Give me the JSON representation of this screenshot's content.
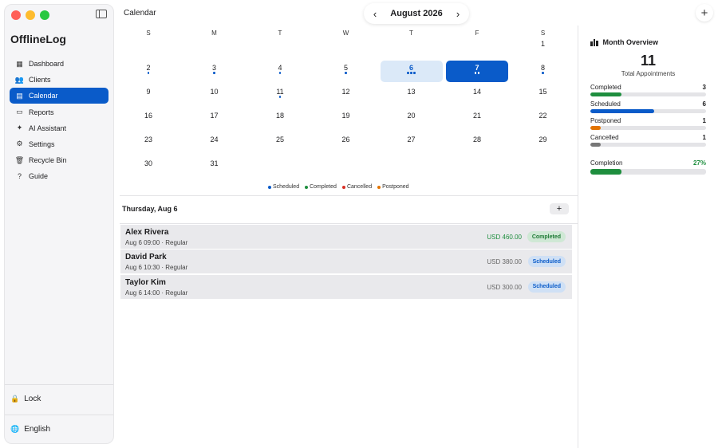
{
  "app": {
    "title": "OfflineLog"
  },
  "sidebar": {
    "items": [
      {
        "label": "Dashboard",
        "icon": "grid-icon",
        "glyph": "▦",
        "active": false
      },
      {
        "label": "Clients",
        "icon": "people-icon",
        "glyph": "👥",
        "active": false
      },
      {
        "label": "Calendar",
        "icon": "calendar-icon",
        "glyph": "▤",
        "active": true
      },
      {
        "label": "Reports",
        "icon": "document-icon",
        "glyph": "▭",
        "active": false
      },
      {
        "label": "AI Assistant",
        "icon": "sparkle-icon",
        "glyph": "✦",
        "active": false
      },
      {
        "label": "Settings",
        "icon": "gear-icon",
        "glyph": "⚙",
        "active": false
      },
      {
        "label": "Recycle Bin",
        "icon": "trash-icon",
        "glyph": "🗑",
        "active": false
      },
      {
        "label": "Guide",
        "icon": "question-icon",
        "glyph": "?",
        "active": false
      }
    ],
    "lock_label": "Lock",
    "language_label": "English"
  },
  "header": {
    "page_title": "Calendar",
    "month_label": "August 2026",
    "prev_glyph": "‹",
    "next_glyph": "›",
    "add_glyph": "+"
  },
  "calendar": {
    "weekdays": [
      "S",
      "M",
      "T",
      "W",
      "T",
      "F",
      "S"
    ],
    "first_weekday": 6,
    "days_in_month": 31,
    "light_selected": 6,
    "selected_day": 7,
    "day_dots": {
      "2": [
        "scheduled"
      ],
      "3": [
        "scheduled"
      ],
      "4": [
        "scheduled"
      ],
      "5": [
        "scheduled"
      ],
      "6": [
        "scheduled",
        "scheduled",
        "scheduled"
      ],
      "7": [
        "scheduled",
        "scheduled"
      ],
      "8": [
        "scheduled"
      ],
      "11": [
        "scheduled"
      ]
    },
    "legend": [
      {
        "label": "Scheduled",
        "color": "#0a5bc9"
      },
      {
        "label": "Completed",
        "color": "#1e8e3e"
      },
      {
        "label": "Cancelled",
        "color": "#d93025"
      },
      {
        "label": "Postponed",
        "color": "#e37400"
      }
    ]
  },
  "day_panel": {
    "title": "Thursday, Aug 6",
    "add_glyph": "+",
    "appointments": [
      {
        "name": "Alex Rivera",
        "date": "Aug 6",
        "time": "09:00",
        "sep": "·",
        "type": "Regular",
        "price": "USD 460.00",
        "status": "Completed",
        "status_key": "completed"
      },
      {
        "name": "David Park",
        "date": "Aug 6",
        "time": "10:30",
        "sep": "·",
        "type": "Regular",
        "price": "USD 380.00",
        "status": "Scheduled",
        "status_key": "scheduled"
      },
      {
        "name": "Taylor Kim",
        "date": "Aug 6",
        "time": "14:00",
        "sep": "·",
        "type": "Regular",
        "price": "USD 300.00",
        "status": "Scheduled",
        "status_key": "scheduled"
      }
    ]
  },
  "overview": {
    "title": "Month Overview",
    "total": "11",
    "total_label": "Total Appointments",
    "stats": [
      {
        "label": "Completed",
        "value": "3",
        "fraction": 0.27,
        "color": "#1e8e3e"
      },
      {
        "label": "Scheduled",
        "value": "6",
        "fraction": 0.55,
        "color": "#0a5bc9"
      },
      {
        "label": "Postponed",
        "value": "1",
        "fraction": 0.09,
        "color": "#e37400"
      },
      {
        "label": "Cancelled",
        "value": "1",
        "fraction": 0.09,
        "color": "#777777"
      }
    ],
    "completion": {
      "label": "Completion",
      "value": "27%",
      "fraction": 0.27,
      "color": "#1e8e3e"
    }
  }
}
